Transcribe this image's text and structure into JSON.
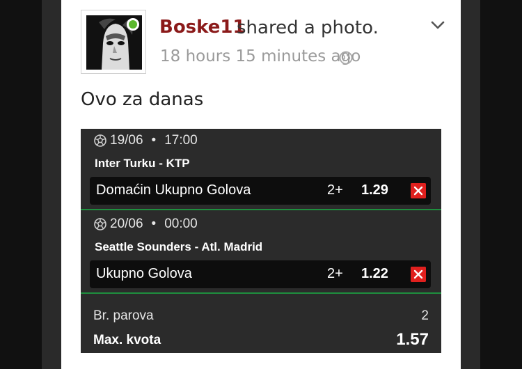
{
  "post": {
    "username": "Boske11",
    "action": "shared a photo.",
    "timestamp": "18 hours 15 minutes ago",
    "text": "Ovo za danas",
    "avatar_status_color": "#5cb82e",
    "privacy_icon": "globe-icon",
    "menu_icon": "chevron-down-icon"
  },
  "ticket": {
    "matches": [
      {
        "date": "19/06",
        "separator": "•",
        "time": "17:00",
        "teams": "Inter Turku - KTP",
        "bet": "Domaćin Ukupno Golova",
        "spec": "2+",
        "odd": "1.29"
      },
      {
        "date": "20/06",
        "separator": "•",
        "time": "00:00",
        "teams": "Seattle Sounders - Atl. Madrid",
        "bet": "Ukupno Golova",
        "spec": "2+",
        "odd": "1.22"
      }
    ],
    "summary": {
      "pairs_label": "Br. parova",
      "pairs_value": "2",
      "max_odds_label": "Max. kvota",
      "max_odds_value": "1.57"
    },
    "colors": {
      "background": "#2b2b2b",
      "separator": "#1e8f3e",
      "lost": "#e0201e"
    }
  }
}
